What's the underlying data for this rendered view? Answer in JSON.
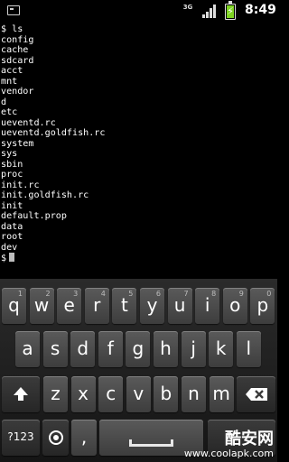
{
  "status_bar": {
    "network": "3G",
    "time": "8:49"
  },
  "terminal": {
    "lines": [
      "$ ls",
      "config",
      "cache",
      "sdcard",
      "acct",
      "mnt",
      "vendor",
      "d",
      "etc",
      "ueventd.rc",
      "ueventd.goldfish.rc",
      "system",
      "sys",
      "sbin",
      "proc",
      "init.rc",
      "init.goldfish.rc",
      "init",
      "default.prop",
      "data",
      "root",
      "dev"
    ],
    "prompt": "$"
  },
  "keyboard": {
    "row1": [
      {
        "label": "q",
        "hint": "1"
      },
      {
        "label": "w",
        "hint": "2"
      },
      {
        "label": "e",
        "hint": "3"
      },
      {
        "label": "r",
        "hint": "4"
      },
      {
        "label": "t",
        "hint": "5"
      },
      {
        "label": "y",
        "hint": "6"
      },
      {
        "label": "u",
        "hint": "7"
      },
      {
        "label": "i",
        "hint": "8"
      },
      {
        "label": "o",
        "hint": "9"
      },
      {
        "label": "p",
        "hint": "0"
      }
    ],
    "row2": [
      "a",
      "s",
      "d",
      "f",
      "g",
      "h",
      "j",
      "k",
      "l"
    ],
    "row3": [
      "z",
      "x",
      "c",
      "v",
      "b",
      "n",
      "m"
    ],
    "symbols_label": "?123",
    "comma_label": ","
  },
  "watermark": {
    "title": "酷安网",
    "url": "www.coolapk.com"
  }
}
